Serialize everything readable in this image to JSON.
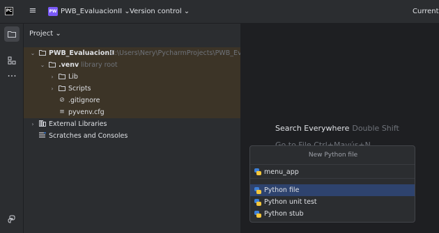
{
  "titlebar": {
    "logo": "PC",
    "project_badge": "PW",
    "project_name": "PWB_EvaluacionII ⌄",
    "vcs_label": "Version control ⌄",
    "current_file": "Current F"
  },
  "toolstrip": {
    "icons": [
      "folder-icon",
      "structure-icon",
      "more-icon",
      "python-console-icon"
    ]
  },
  "project_panel": {
    "title": "Project ⌄",
    "tree": [
      {
        "label": "PWB_EvaluacionII",
        "path": "C:\\Users\\Nery\\PycharmProjects\\PWB_Evalu"
      },
      {
        "label": ".venv",
        "note": "library root"
      },
      {
        "label": "Lib"
      },
      {
        "label": "Scripts"
      },
      {
        "label": ".gitignore"
      },
      {
        "label": "pyvenv.cfg"
      },
      {
        "label": "External Libraries"
      },
      {
        "label": "Scratches and Consoles"
      }
    ]
  },
  "editor": {
    "search_label": "Search Everywhere",
    "search_shortcut": "Double Shift",
    "goto_label": "Go to File  Ctrl+Mayús+N"
  },
  "popup": {
    "title": "New Python file",
    "name_value": "menu_app",
    "options": [
      "Python file",
      "Python unit test",
      "Python stub"
    ],
    "selected_index": 0
  },
  "colors": {
    "background": "#1e1f22",
    "panel": "#2b2d30",
    "excluded_highlight": "#3c3427",
    "selection": "#2e436e",
    "badge": "#7a5af8"
  }
}
